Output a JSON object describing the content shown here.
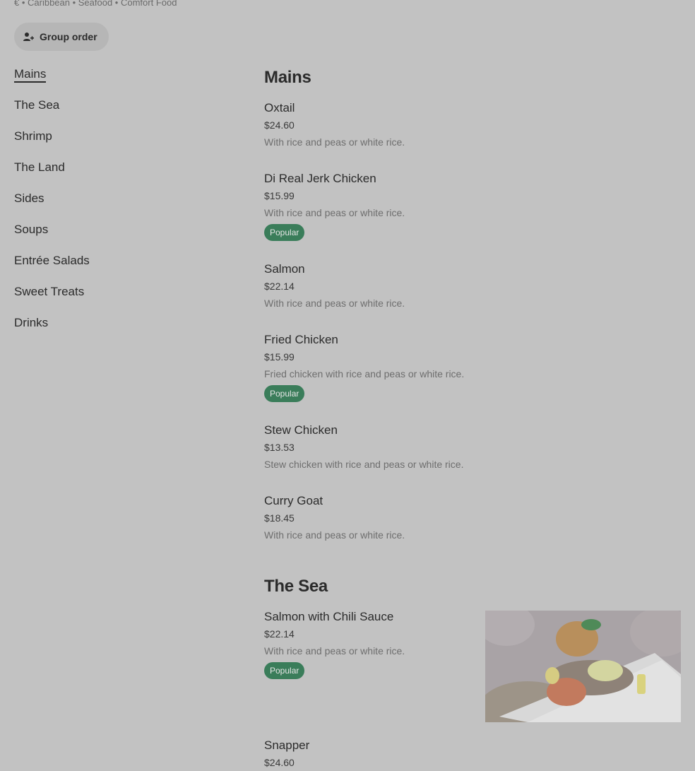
{
  "store_meta": "€ • Caribbean • Seafood • Comfort Food",
  "group_order": {
    "label": "Group order",
    "icon": "person-add-icon"
  },
  "nav": {
    "items": [
      {
        "label": "Mains",
        "active": true
      },
      {
        "label": "The Sea"
      },
      {
        "label": "Shrimp"
      },
      {
        "label": "The Land"
      },
      {
        "label": "Sides"
      },
      {
        "label": "Soups"
      },
      {
        "label": "Entrée Salads"
      },
      {
        "label": "Sweet Treats"
      },
      {
        "label": "Drinks"
      }
    ]
  },
  "sections": [
    {
      "title": "Mains",
      "items": [
        {
          "name": "Oxtail",
          "price": "$24.60",
          "desc": "With rice and peas or white rice."
        },
        {
          "name": "Di Real Jerk Chicken",
          "price": "$15.99",
          "desc": "With rice and peas or white rice.",
          "badge": "Popular"
        },
        {
          "name": "Salmon",
          "price": "$22.14",
          "desc": "With rice and peas or white rice."
        },
        {
          "name": "Fried Chicken",
          "price": "$15.99",
          "desc": "Fried chicken with rice and peas or white rice.",
          "badge": "Popular"
        },
        {
          "name": "Stew Chicken",
          "price": "$13.53",
          "desc": "Stew chicken with rice and peas or white rice."
        },
        {
          "name": "Curry Goat",
          "price": "$18.45",
          "desc": "With rice and peas or white rice."
        }
      ]
    },
    {
      "title": "The Sea",
      "items": [
        {
          "name": "Salmon with Chili Sauce",
          "price": "$22.14",
          "desc": "With rice and peas or white rice.",
          "badge": "Popular",
          "image": "salmon-dish-photo"
        },
        {
          "name": "Snapper",
          "price": "$24.60"
        }
      ]
    }
  ],
  "colors": {
    "background": "#c2c2c2",
    "badge": "#3a7d5a",
    "text": "#2b2b2b"
  }
}
